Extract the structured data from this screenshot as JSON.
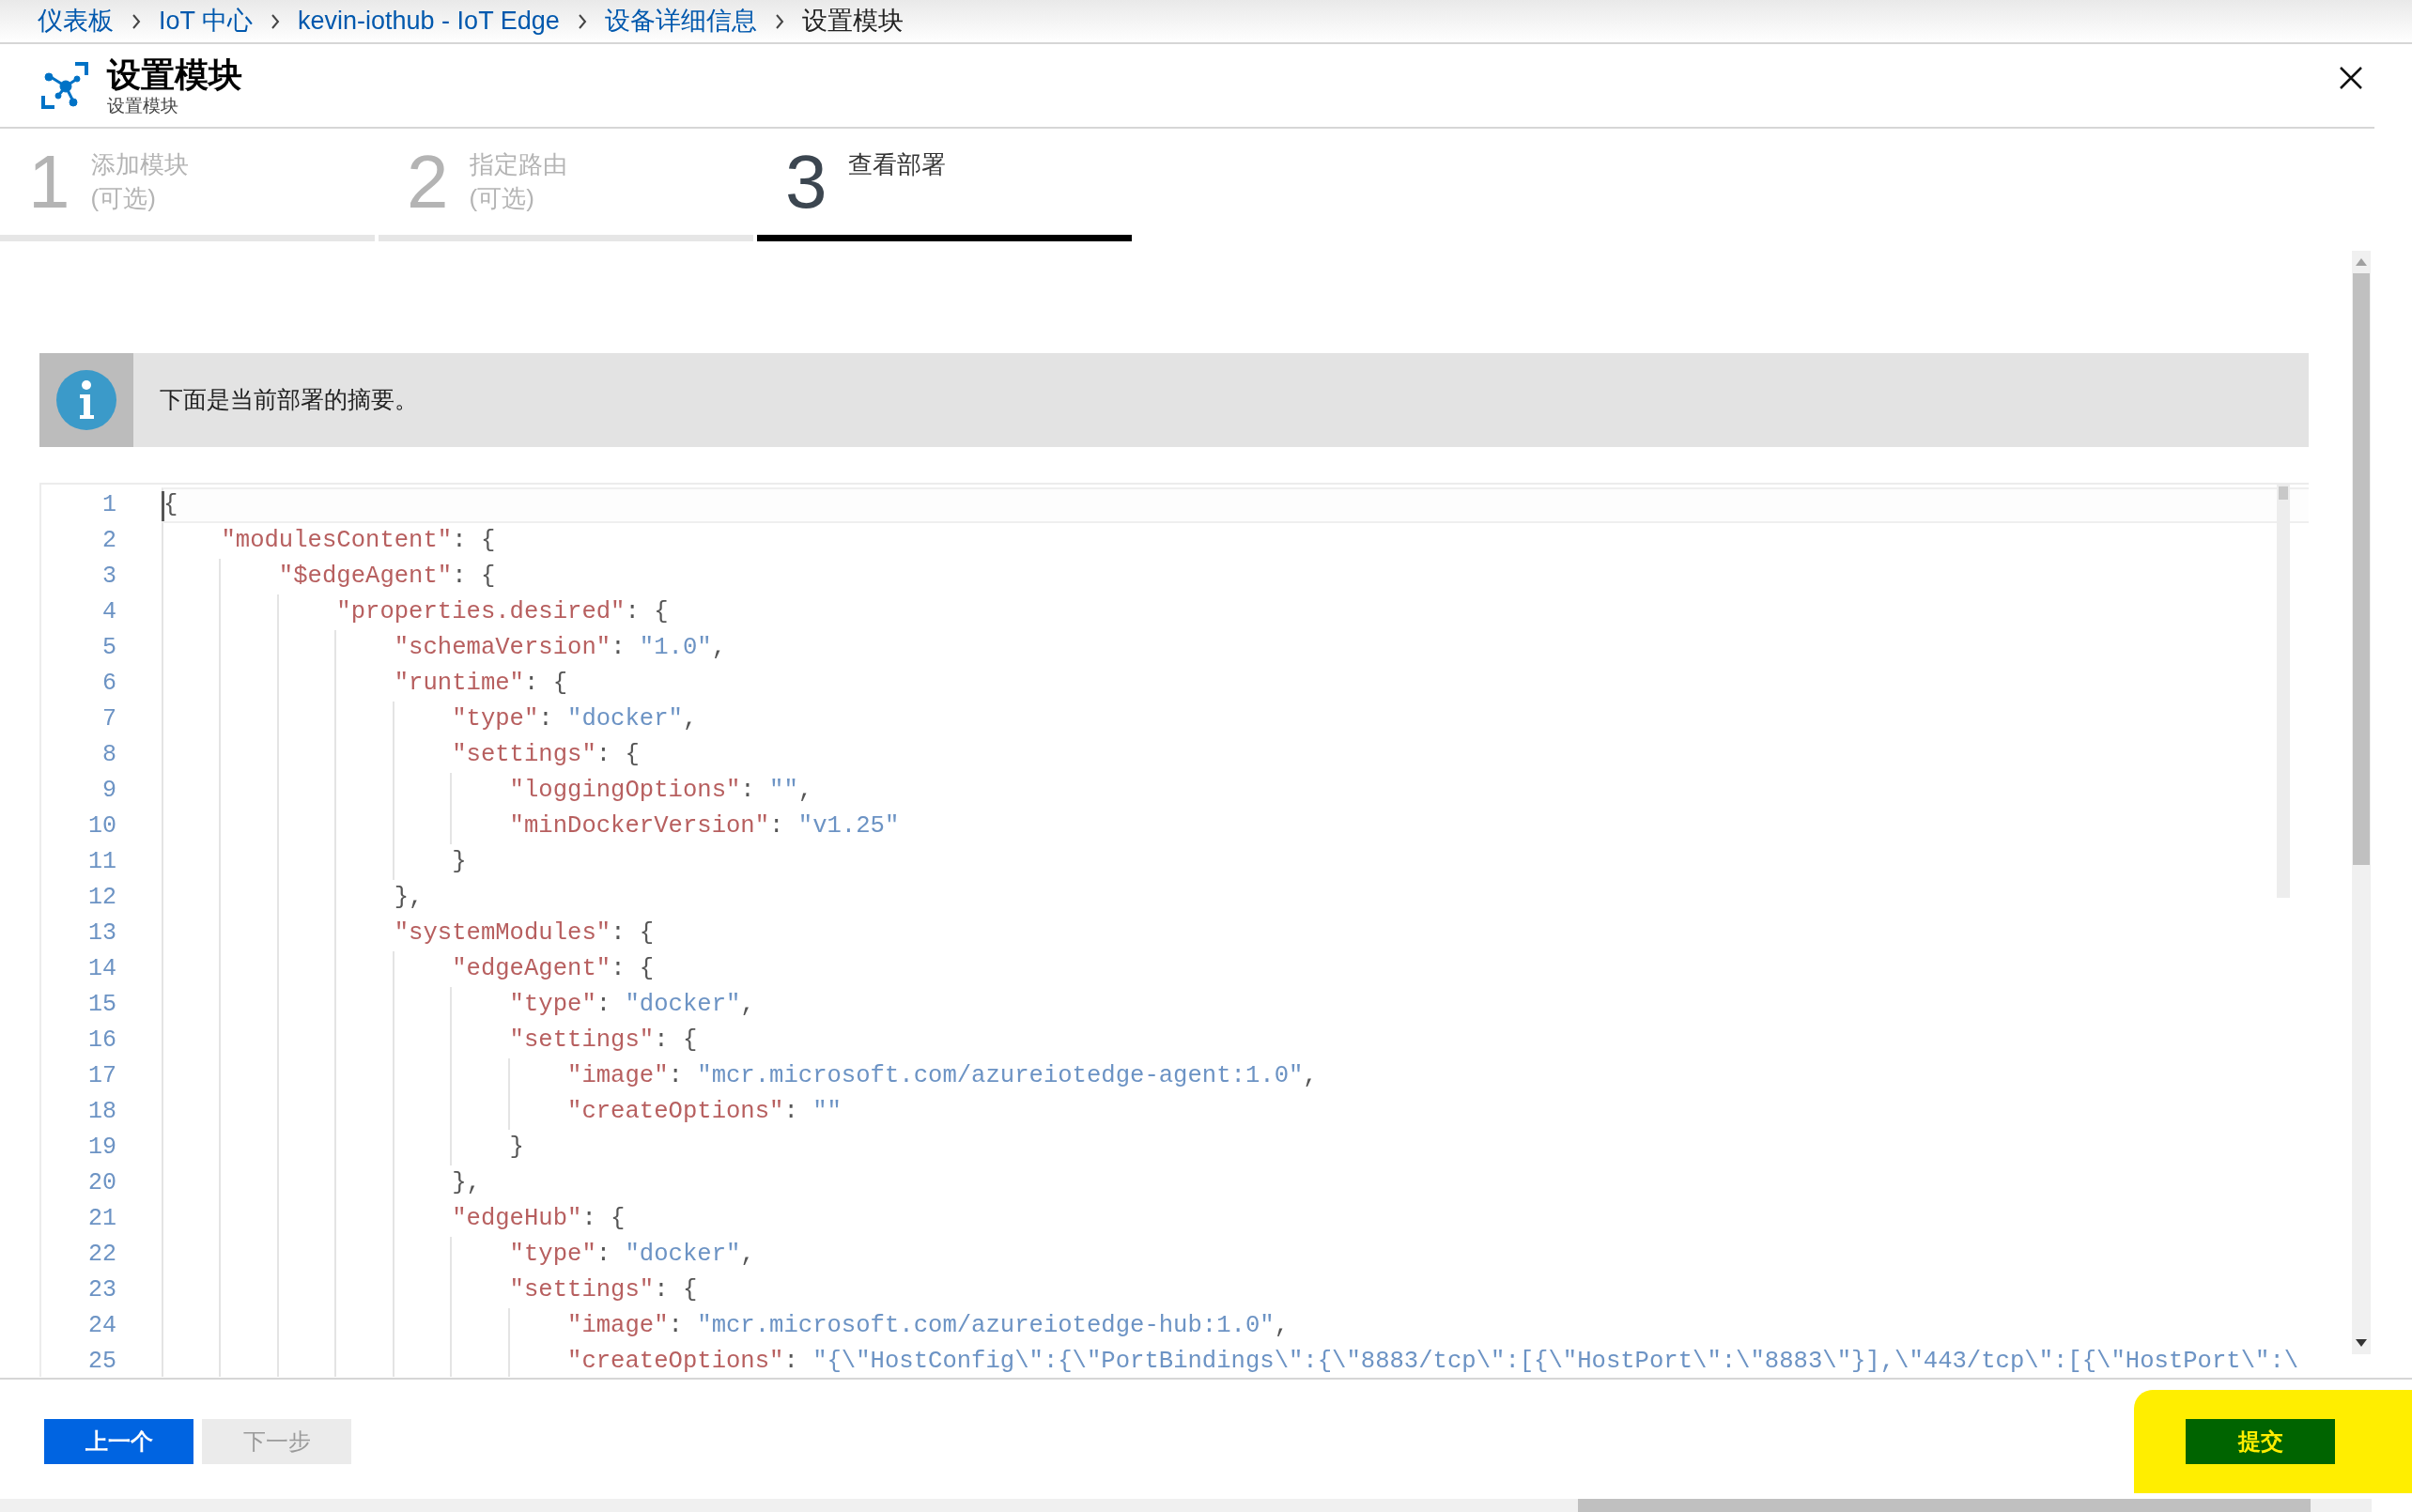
{
  "breadcrumbs": [
    {
      "label": "仪表板",
      "current": false
    },
    {
      "label": "IoT 中心",
      "current": false
    },
    {
      "label": "kevin-iothub - IoT Edge",
      "current": false
    },
    {
      "label": "设备详细信息",
      "current": false
    },
    {
      "label": "设置模块",
      "current": true
    }
  ],
  "blade": {
    "title": "设置模块",
    "subtitle": "设置模块"
  },
  "steps": [
    {
      "number": "1",
      "label": "添加模块",
      "sublabel": "(可选)",
      "selected": false
    },
    {
      "number": "2",
      "label": "指定路由",
      "sublabel": "(可选)",
      "selected": false
    },
    {
      "number": "3",
      "label": "查看部署",
      "selected": true
    }
  ],
  "info": {
    "message": "下面是当前部署的摘要。"
  },
  "editor": {
    "lines": [
      {
        "n": "1",
        "current": true,
        "tokens": [
          {
            "kind": "punct",
            "text": "{"
          }
        ]
      },
      {
        "n": "2",
        "current": false,
        "tokens": [
          {
            "kind": "key",
            "text": "    \"modulesContent\""
          },
          {
            "kind": "punct",
            "text": ": {"
          }
        ]
      },
      {
        "n": "3",
        "current": false,
        "tokens": [
          {
            "kind": "key",
            "text": "        \"$edgeAgent\""
          },
          {
            "kind": "punct",
            "text": ": {"
          }
        ]
      },
      {
        "n": "4",
        "current": false,
        "tokens": [
          {
            "kind": "key",
            "text": "            \"properties.desired\""
          },
          {
            "kind": "punct",
            "text": ": {"
          }
        ]
      },
      {
        "n": "5",
        "current": false,
        "tokens": [
          {
            "kind": "key",
            "text": "                \"schemaVersion\""
          },
          {
            "kind": "punct",
            "text": ": "
          },
          {
            "kind": "string",
            "text": "\"1.0\""
          },
          {
            "kind": "punct",
            "text": ","
          }
        ]
      },
      {
        "n": "6",
        "current": false,
        "tokens": [
          {
            "kind": "key",
            "text": "                \"runtime\""
          },
          {
            "kind": "punct",
            "text": ": {"
          }
        ]
      },
      {
        "n": "7",
        "current": false,
        "tokens": [
          {
            "kind": "key",
            "text": "                    \"type\""
          },
          {
            "kind": "punct",
            "text": ": "
          },
          {
            "kind": "string",
            "text": "\"docker\""
          },
          {
            "kind": "punct",
            "text": ","
          }
        ]
      },
      {
        "n": "8",
        "current": false,
        "tokens": [
          {
            "kind": "key",
            "text": "                    \"settings\""
          },
          {
            "kind": "punct",
            "text": ": {"
          }
        ]
      },
      {
        "n": "9",
        "current": false,
        "tokens": [
          {
            "kind": "key",
            "text": "                        \"loggingOptions\""
          },
          {
            "kind": "punct",
            "text": ": "
          },
          {
            "kind": "string",
            "text": "\"\""
          },
          {
            "kind": "punct",
            "text": ","
          }
        ]
      },
      {
        "n": "10",
        "current": false,
        "tokens": [
          {
            "kind": "key",
            "text": "                        \"minDockerVersion\""
          },
          {
            "kind": "punct",
            "text": ": "
          },
          {
            "kind": "string",
            "text": "\"v1.25\""
          }
        ]
      },
      {
        "n": "11",
        "current": false,
        "tokens": [
          {
            "kind": "punct",
            "text": "                    }"
          }
        ]
      },
      {
        "n": "12",
        "current": false,
        "tokens": [
          {
            "kind": "punct",
            "text": "                },"
          }
        ]
      },
      {
        "n": "13",
        "current": false,
        "tokens": [
          {
            "kind": "key",
            "text": "                \"systemModules\""
          },
          {
            "kind": "punct",
            "text": ": {"
          }
        ]
      },
      {
        "n": "14",
        "current": false,
        "tokens": [
          {
            "kind": "key",
            "text": "                    \"edgeAgent\""
          },
          {
            "kind": "punct",
            "text": ": {"
          }
        ]
      },
      {
        "n": "15",
        "current": false,
        "tokens": [
          {
            "kind": "key",
            "text": "                        \"type\""
          },
          {
            "kind": "punct",
            "text": ": "
          },
          {
            "kind": "string",
            "text": "\"docker\""
          },
          {
            "kind": "punct",
            "text": ","
          }
        ]
      },
      {
        "n": "16",
        "current": false,
        "tokens": [
          {
            "kind": "key",
            "text": "                        \"settings\""
          },
          {
            "kind": "punct",
            "text": ": {"
          }
        ]
      },
      {
        "n": "17",
        "current": false,
        "tokens": [
          {
            "kind": "key",
            "text": "                            \"image\""
          },
          {
            "kind": "punct",
            "text": ": "
          },
          {
            "kind": "string",
            "text": "\"mcr.microsoft.com/azureiotedge-agent:1.0\""
          },
          {
            "kind": "punct",
            "text": ","
          }
        ]
      },
      {
        "n": "18",
        "current": false,
        "tokens": [
          {
            "kind": "key",
            "text": "                            \"createOptions\""
          },
          {
            "kind": "punct",
            "text": ": "
          },
          {
            "kind": "string",
            "text": "\"\""
          }
        ]
      },
      {
        "n": "19",
        "current": false,
        "tokens": [
          {
            "kind": "punct",
            "text": "                        }"
          }
        ]
      },
      {
        "n": "20",
        "current": false,
        "tokens": [
          {
            "kind": "punct",
            "text": "                    },"
          }
        ]
      },
      {
        "n": "21",
        "current": false,
        "tokens": [
          {
            "kind": "key",
            "text": "                    \"edgeHub\""
          },
          {
            "kind": "punct",
            "text": ": {"
          }
        ]
      },
      {
        "n": "22",
        "current": false,
        "tokens": [
          {
            "kind": "key",
            "text": "                        \"type\""
          },
          {
            "kind": "punct",
            "text": ": "
          },
          {
            "kind": "string",
            "text": "\"docker\""
          },
          {
            "kind": "punct",
            "text": ","
          }
        ]
      },
      {
        "n": "23",
        "current": false,
        "tokens": [
          {
            "kind": "key",
            "text": "                        \"settings\""
          },
          {
            "kind": "punct",
            "text": ": {"
          }
        ]
      },
      {
        "n": "24",
        "current": false,
        "tokens": [
          {
            "kind": "key",
            "text": "                            \"image\""
          },
          {
            "kind": "punct",
            "text": ": "
          },
          {
            "kind": "string",
            "text": "\"mcr.microsoft.com/azureiotedge-hub:1.0\""
          },
          {
            "kind": "punct",
            "text": ","
          }
        ]
      },
      {
        "n": "25",
        "current": false,
        "tokens": [
          {
            "kind": "key",
            "text": "                            \"createOptions\""
          },
          {
            "kind": "punct",
            "text": ": "
          },
          {
            "kind": "string",
            "text": "\"{\\\"HostConfig\\\":{\\\"PortBindings\\\":{\\\"8883/tcp\\\":[{\\\"HostPort\\\":\\\"8883\\\"}],\\\"443/tcp\\\":[{\\\"HostPort\\\":\\"
          }
        ]
      }
    ]
  },
  "footer": {
    "buttons": [
      {
        "label": "上一个",
        "kind": "primary",
        "disabled": false
      },
      {
        "label": "下一步",
        "kind": "secondary",
        "disabled": true
      }
    ],
    "submit": {
      "label": "提交",
      "highlighted": true
    }
  }
}
